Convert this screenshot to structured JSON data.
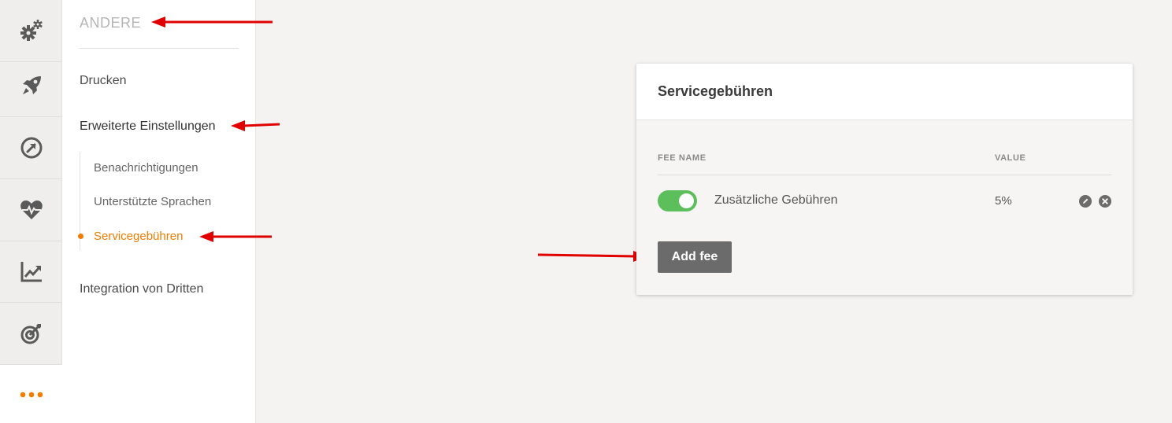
{
  "rail": {
    "items": [
      {
        "icon": "gears-icon"
      },
      {
        "icon": "rocket-icon"
      },
      {
        "icon": "gauge-icon"
      },
      {
        "icon": "heart-pulse-icon"
      },
      {
        "icon": "line-chart-icon"
      },
      {
        "icon": "target-icon"
      },
      {
        "icon": "more-dots-icon",
        "active": true
      }
    ]
  },
  "submenu": {
    "section_title": "ANDERE",
    "links": {
      "drucken": "Drucken",
      "erweiterte": "Erweiterte Einstellungen",
      "integration": "Integration von Dritten"
    },
    "sub_links": {
      "benachrichtigungen": "Benachrichtigungen",
      "sprachen": "Unterstützte Sprachen",
      "servicegebuehren": "Servicegebühren"
    }
  },
  "card": {
    "title": "Servicegebühren",
    "columns": {
      "fee_name": "FEE NAME",
      "value": "VALUE"
    },
    "rows": [
      {
        "enabled": true,
        "name": "Zusätzliche Gebühren",
        "value": "5%"
      }
    ],
    "add_button": "Add fee"
  },
  "colors": {
    "accent": "#f07c00",
    "toggle_on": "#5cbf5c",
    "button": "#6b6b6b",
    "annotation_arrow": "#e00000"
  }
}
